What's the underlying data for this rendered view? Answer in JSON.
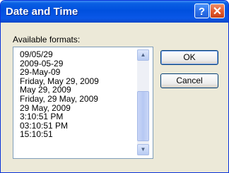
{
  "window": {
    "title": "Date and Time",
    "help_symbol": "?",
    "close_symbol": "✕"
  },
  "formats": {
    "label": "Available formats:",
    "items": [
      "09/05/29",
      "2009-05-29",
      "29-May-09",
      "Friday, May 29, 2009",
      "May 29, 2009",
      "Friday, 29 May, 2009",
      "29 May, 2009",
      "3:10:51 PM",
      "03:10:51 PM",
      "15:10:51"
    ],
    "scroll_up_symbol": "▲",
    "scroll_down_symbol": "▼"
  },
  "buttons": {
    "ok_label": "OK",
    "cancel_label": "Cancel"
  },
  "colors": {
    "titlebar": "#0050de",
    "dialog_background": "#ece9d8",
    "close_button": "#e2582c",
    "button_border": "#003c74"
  }
}
